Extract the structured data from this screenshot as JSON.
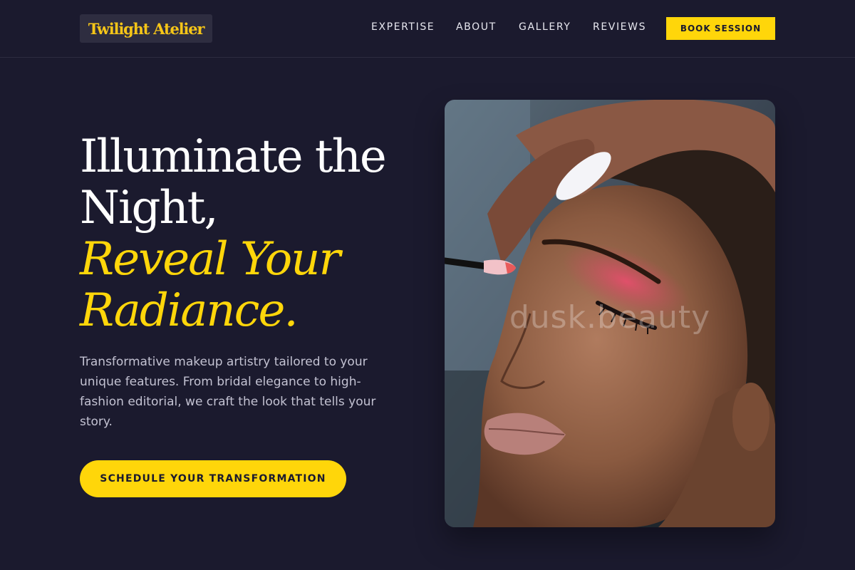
{
  "brand": {
    "logo_text": "Twilight Atelier"
  },
  "nav": {
    "items": [
      {
        "label": "EXPERTISE"
      },
      {
        "label": "ABOUT"
      },
      {
        "label": "GALLERY"
      },
      {
        "label": "REVIEWS"
      }
    ],
    "cta_label": "BOOK SESSION"
  },
  "hero": {
    "title_line1": "Illuminate the",
    "title_line2": "Night,",
    "accent_line1": "Reveal Your",
    "accent_line2": "Radiance.",
    "description": "Transformative makeup artistry tailored to your unique features. From bridal elegance to high-fashion editorial, we craft the look that tells your story.",
    "cta_label": "SCHEDULE YOUR TRANSFORMATION"
  },
  "image": {
    "watermark": "dusk.beauty"
  },
  "colors": {
    "background": "#1b1a2e",
    "accent": "#ffd60a",
    "text": "#ffffff",
    "muted_text": "#c3c2d2"
  }
}
